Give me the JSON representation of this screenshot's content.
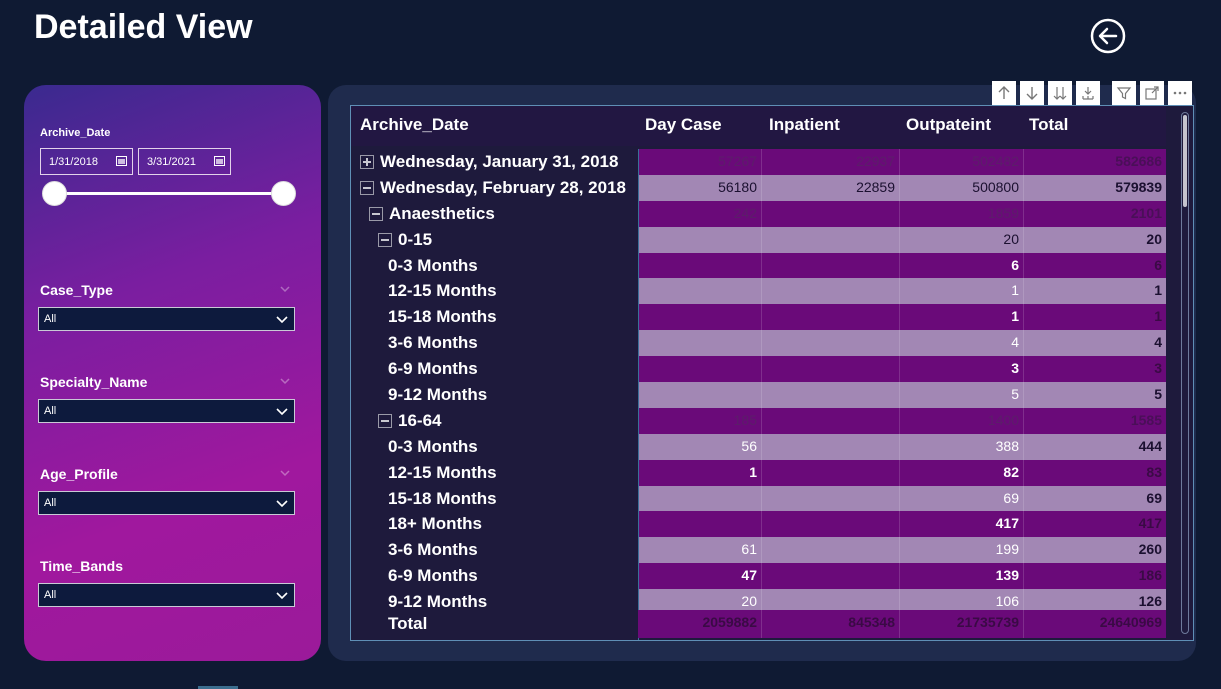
{
  "page": {
    "title": "Detailed View"
  },
  "filters": {
    "archive_date": {
      "label": "Archive_Date",
      "start": "1/31/2018",
      "end": "3/31/2021"
    },
    "case_type": {
      "label": "Case_Type",
      "value": "All"
    },
    "specialty_name": {
      "label": "Specialty_Name",
      "value": "All"
    },
    "age_profile": {
      "label": "Age_Profile",
      "value": "All"
    },
    "time_bands": {
      "label": "Time_Bands",
      "value": "All"
    }
  },
  "matrix": {
    "columns": [
      "Archive_Date",
      "Day Case",
      "Inpatient",
      "Outpateint",
      "Total"
    ],
    "rows": [
      {
        "label": "Wednesday, January 31, 2018",
        "toggle": "plus",
        "day_case": "57267",
        "inpatient": "22937",
        "outpatient": "502482",
        "total": "582686"
      },
      {
        "label": "Wednesday, February 28, 2018",
        "toggle": "minus",
        "day_case": "56180",
        "inpatient": "22859",
        "outpatient": "500800",
        "total": "579839"
      },
      {
        "label": "Anaesthetics",
        "toggle": "minus",
        "day_case": "242",
        "inpatient": "",
        "outpatient": "1859",
        "total": "2101"
      },
      {
        "label": "0-15",
        "toggle": "minus",
        "day_case": "",
        "inpatient": "",
        "outpatient": "20",
        "total": "20"
      },
      {
        "label": "0-3 Months",
        "toggle": "",
        "day_case": "",
        "inpatient": "",
        "outpatient": "6",
        "total": "6"
      },
      {
        "label": "12-15 Months",
        "toggle": "",
        "day_case": "",
        "inpatient": "",
        "outpatient": "1",
        "total": "1"
      },
      {
        "label": "15-18 Months",
        "toggle": "",
        "day_case": "",
        "inpatient": "",
        "outpatient": "1",
        "total": "1"
      },
      {
        "label": "3-6 Months",
        "toggle": "",
        "day_case": "",
        "inpatient": "",
        "outpatient": "4",
        "total": "4"
      },
      {
        "label": "6-9 Months",
        "toggle": "",
        "day_case": "",
        "inpatient": "",
        "outpatient": "3",
        "total": "3"
      },
      {
        "label": "9-12 Months",
        "toggle": "",
        "day_case": "",
        "inpatient": "",
        "outpatient": "5",
        "total": "5"
      },
      {
        "label": "16-64",
        "toggle": "minus",
        "day_case": "185",
        "inpatient": "",
        "outpatient": "1400",
        "total": "1585"
      },
      {
        "label": "0-3 Months",
        "toggle": "",
        "day_case": "56",
        "inpatient": "",
        "outpatient": "388",
        "total": "444"
      },
      {
        "label": "12-15 Months",
        "toggle": "",
        "day_case": "1",
        "inpatient": "",
        "outpatient": "82",
        "total": "83"
      },
      {
        "label": "15-18 Months",
        "toggle": "",
        "day_case": "",
        "inpatient": "",
        "outpatient": "69",
        "total": "69"
      },
      {
        "label": "18+ Months",
        "toggle": "",
        "day_case": "",
        "inpatient": "",
        "outpatient": "417",
        "total": "417"
      },
      {
        "label": "3-6 Months",
        "toggle": "",
        "day_case": "61",
        "inpatient": "",
        "outpatient": "199",
        "total": "260"
      },
      {
        "label": "6-9 Months",
        "toggle": "",
        "day_case": "47",
        "inpatient": "",
        "outpatient": "139",
        "total": "186"
      },
      {
        "label": "9-12 Months",
        "toggle": "",
        "day_case": "20",
        "inpatient": "",
        "outpatient": "106",
        "total": "126"
      }
    ],
    "total": {
      "label": "Total",
      "day_case": "2059882",
      "inpatient": "845348",
      "outpatient": "21735739",
      "total": "24640969"
    }
  },
  "colors": {
    "panel_accent": "#a0189e",
    "row_light": "#a287b4",
    "row_dark": "#6a0a79",
    "background": "#0f1a33"
  }
}
